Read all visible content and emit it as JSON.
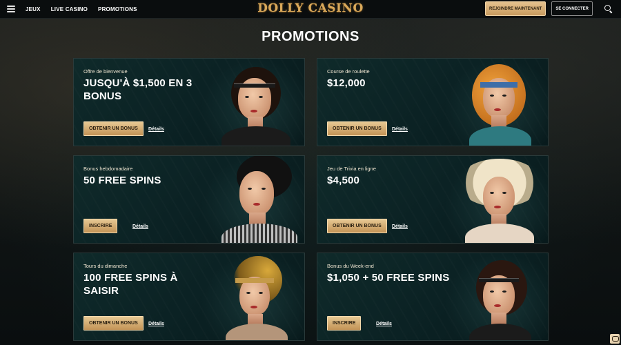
{
  "header": {
    "nav": [
      "JEUX",
      "LIVE CASINO",
      "PROMOTIONS"
    ],
    "logo": "DOLLY CASINO",
    "join_label": "REJOINDRE MAINTENANT",
    "login_label": "SE CONNECTER"
  },
  "page": {
    "title": "PROMOTIONS"
  },
  "promotions": [
    {
      "subtitle": "Offre de bienvenue",
      "headline": "JUSQU'À $1,500 EN 3 BONUS",
      "cta": "OBTENIR UN BONUS",
      "details": "Détails"
    },
    {
      "subtitle": "Course de roulette",
      "headline": "$12,000",
      "cta": "OBTENIR UN BONUS",
      "details": "Détails"
    },
    {
      "subtitle": "Bonus hebdomadaire",
      "headline": "50 FREE SPINS",
      "cta": "INSCRIRE",
      "details": "Détails"
    },
    {
      "subtitle": "Jeu de Trivia en ligne",
      "headline": "$4,500",
      "cta": "OBTENIR UN BONUS",
      "details": "Détails"
    },
    {
      "subtitle": "Tours du dimanche",
      "headline": "100 FREE SPINS À SAISIR",
      "cta": "OBTENIR UN BONUS",
      "details": "Détails"
    },
    {
      "subtitle": "Bonus du Week-end",
      "headline": "$1,050 + 50 FREE SPINS",
      "cta": "INSCRIRE",
      "details": "Détails"
    }
  ],
  "colors": {
    "gold": "#d9a85a",
    "card_bg": "#0b2224",
    "button": "#c79a5f"
  }
}
